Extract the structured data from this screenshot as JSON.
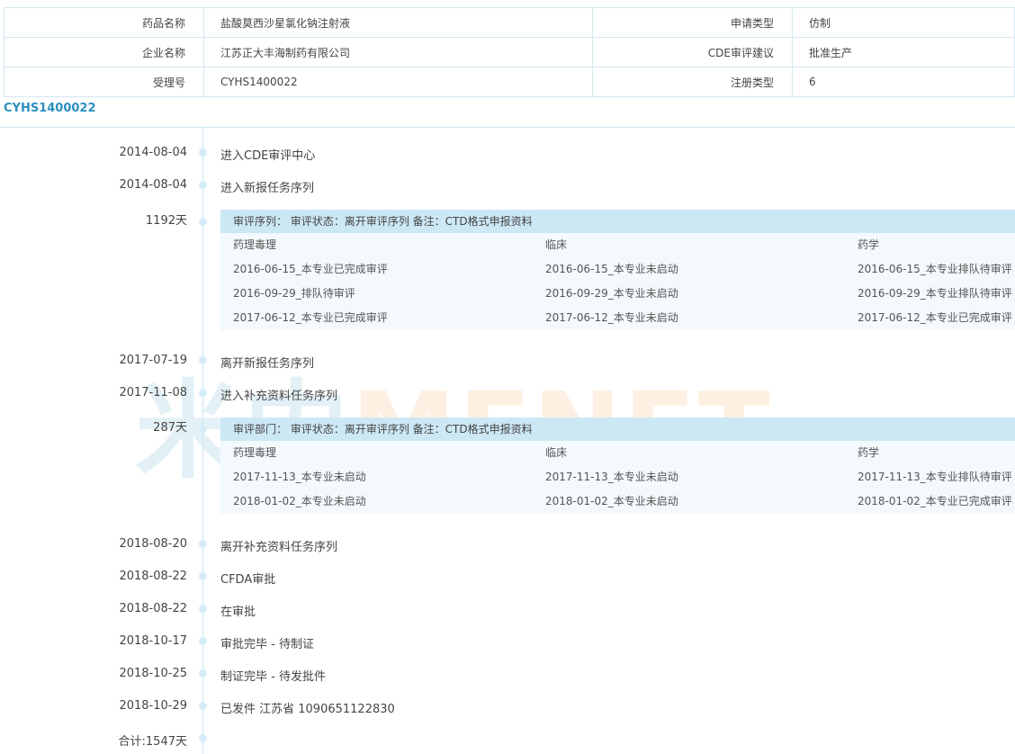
{
  "info": {
    "rows": [
      {
        "l1": "药品名称",
        "v1": "盐酸莫西沙星氯化钠注射液",
        "l2": "申请类型",
        "v2": "仿制"
      },
      {
        "l1": "企业名称",
        "v1": "江苏正大丰海制药有限公司",
        "l2": "CDE审评建议",
        "v2": "批准生产"
      },
      {
        "l1": "受理号",
        "v1": "CYHS1400022",
        "l2": "注册类型",
        "v2": "6"
      }
    ]
  },
  "code_title": "CYHS1400022",
  "watermark": {
    "part_a": "米内",
    "part_b": "MENET"
  },
  "timeline": {
    "e0": {
      "date": "2014-08-04",
      "text": "进入CDE审评中心"
    },
    "e1": {
      "date": "2014-08-04",
      "text": "进入新报任务序列"
    },
    "d1": {
      "duration": "1192天"
    },
    "box1": {
      "header": "审评序列： 审评状态：离开审评序列 备注：CTD格式申报资料",
      "columns": [
        "药理毒理",
        "临床",
        "药学"
      ],
      "rows": [
        [
          "2016-06-15_本专业已完成审评",
          "2016-06-15_本专业未启动",
          "2016-06-15_本专业排队待审评"
        ],
        [
          "2016-09-29_排队待审评",
          "2016-09-29_本专业未启动",
          "2016-09-29_本专业排队待审评"
        ],
        [
          "2017-06-12_本专业已完成审评",
          "2017-06-12_本专业未启动",
          "2017-06-12_本专业已完成审评"
        ]
      ]
    },
    "e2": {
      "date": "2017-07-19",
      "text": "离开新报任务序列"
    },
    "e3": {
      "date": "2017-11-08",
      "text": "进入补充资料任务序列"
    },
    "d2": {
      "duration": "287天"
    },
    "box2": {
      "header": "审评部门： 审评状态：离开审评序列 备注：CTD格式申报资料",
      "columns": [
        "药理毒理",
        "临床",
        "药学"
      ],
      "rows": [
        [
          "2017-11-13_本专业未启动",
          "2017-11-13_本专业未启动",
          "2017-11-13_本专业排队待审评"
        ],
        [
          "2018-01-02_本专业未启动",
          "2018-01-02_本专业未启动",
          "2018-01-02_本专业已完成审评"
        ]
      ]
    },
    "e4": {
      "date": "2018-08-20",
      "text": "离开补充资料任务序列"
    },
    "e5": {
      "date": "2018-08-22",
      "text": "CFDA审批"
    },
    "e6": {
      "date": "2018-08-22",
      "text": "在审批"
    },
    "e7": {
      "date": "2018-10-17",
      "text": "审批完毕 - 待制证"
    },
    "e8": {
      "date": "2018-10-25",
      "text": "制证完毕 - 待发批件"
    },
    "e9": {
      "date": "2018-10-29",
      "text": "已发件 江苏省 1090651122830"
    },
    "total": "合计:1547天"
  }
}
